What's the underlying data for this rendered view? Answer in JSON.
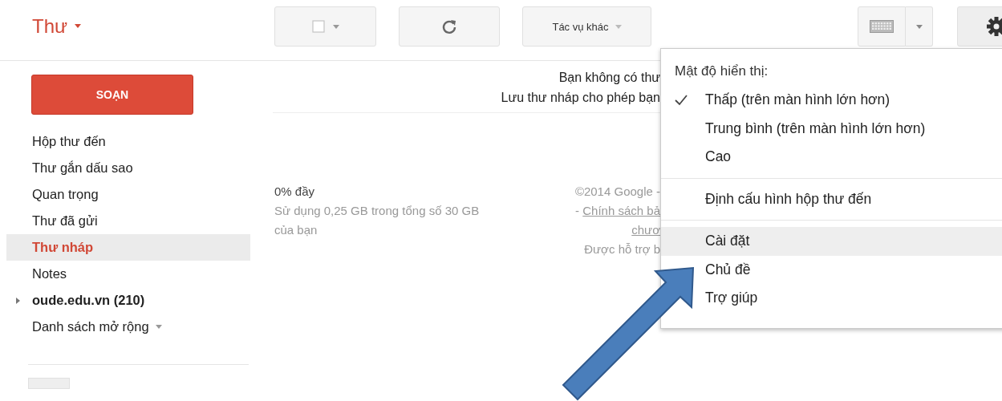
{
  "header": {
    "title": "Thư"
  },
  "toolbar": [
    {
      "kind": "select"
    },
    {
      "kind": "refresh"
    },
    {
      "kind": "more",
      "label": "Tác vụ khác"
    },
    {
      "kind": "keyboard"
    },
    {
      "kind": "settings"
    }
  ],
  "compose_button": "SOẠN",
  "sidebar": {
    "items": [
      {
        "kind": "folder",
        "label": "Hộp thư đến",
        "selected": false
      },
      {
        "kind": "folder",
        "label": "Thư gắn dấu sao",
        "selected": false
      },
      {
        "kind": "folder",
        "label": "Quan trọng",
        "selected": false
      },
      {
        "kind": "folder",
        "label": "Thư đã gửi",
        "selected": false
      },
      {
        "kind": "folder",
        "label": "Thư nháp",
        "selected": true
      },
      {
        "kind": "folder",
        "label": "Notes",
        "selected": false
      },
      {
        "kind": "group",
        "label": "oude.edu.vn (210)",
        "selected": false,
        "expanded": false
      },
      {
        "kind": "more",
        "label": "Danh sách mở rộng",
        "selected": false
      }
    ]
  },
  "empty_message": [
    "Bạn không có thư",
    "Lưu thư nháp cho phép bạn"
  ],
  "storage": {
    "usage": "0% đầy",
    "detail": "Sử dụng 0,25 GB trong tổng số 30 GB của bạn"
  },
  "footer_lines": [
    {
      "text": "©2014 Google -"
    },
    {
      "text": "- ",
      "link": "Chính sách bả"
    },
    {
      "link": "chươ"
    },
    {
      "text": "Được hỗ trợ b"
    }
  ],
  "settings_menu": {
    "sections": [
      {
        "heading": "Mật độ hiển thị:",
        "items": [
          {
            "label": "Thấp (trên màn hình lớn hơn)",
            "selected": true
          },
          {
            "label": "Trung bình (trên màn hình lớn hơn)",
            "selected": false
          },
          {
            "label": "Cao",
            "selected": false
          }
        ]
      },
      {
        "items": [
          {
            "label": "Định cấu hình hộp thư đến",
            "highlighted": false
          }
        ]
      },
      {
        "items": [
          {
            "label": "Cài đặt",
            "highlighted": true
          },
          {
            "label": "Chủ đề",
            "highlighted": false
          },
          {
            "label": "Trợ giúp",
            "highlighted": false
          }
        ]
      }
    ]
  }
}
